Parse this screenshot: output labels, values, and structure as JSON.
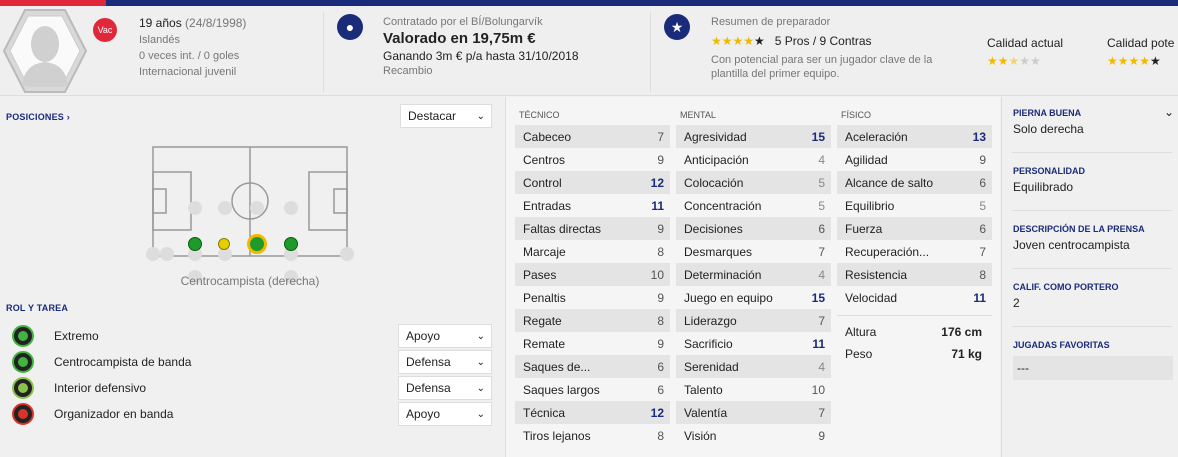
{
  "header": {
    "badge": "Vac",
    "age": "19 años",
    "dob": "(24/8/1998)",
    "nationality": "Islandés",
    "caps": "0 veces int. / 0 goles",
    "youth": "Internacional juvenil",
    "contract_label": "Contratado por el BÍ/Bolungarvík",
    "value": "Valorado en 19,75m €",
    "wage": "Ganando 3m € p/a hasta 31/10/2018",
    "status": "Recambio",
    "coach_title": "Resumen de preparador",
    "pros_cons": "5 Pros / 9 Contras",
    "coach_note_1": "Con potencial para ser un jugador clave de la",
    "coach_note_2": "plantilla del primer equipo.",
    "current_ability_label": "Calidad actual",
    "potential_ability_label": "Calidad pote",
    "coach_stars": 4,
    "current_stars": 2.5,
    "potential_stars": 4
  },
  "positions": {
    "title": "POSICIONES",
    "highlight": "Destacar",
    "position_label": "Centrocampista (derecha)"
  },
  "roles": {
    "title": "ROL Y TAREA",
    "items": [
      {
        "name": "Extremo",
        "duty": "Apoyo",
        "color": "#3fb53f"
      },
      {
        "name": "Centrocampista de banda",
        "duty": "Defensa",
        "color": "#3fb53f"
      },
      {
        "name": "Interior defensivo",
        "duty": "Defensa",
        "color": "#8bc34a"
      },
      {
        "name": "Organizador en banda",
        "duty": "Apoyo",
        "color": "#d9342b"
      }
    ]
  },
  "attributes": {
    "technical_title": "TÉCNICO",
    "mental_title": "MENTAL",
    "physical_title": "FÍSICO",
    "technical": [
      {
        "name": "Cabeceo",
        "value": "7"
      },
      {
        "name": "Centros",
        "value": "9"
      },
      {
        "name": "Control",
        "value": "12"
      },
      {
        "name": "Entradas",
        "value": "11"
      },
      {
        "name": "Faltas directas",
        "value": "9"
      },
      {
        "name": "Marcaje",
        "value": "8"
      },
      {
        "name": "Pases",
        "value": "10"
      },
      {
        "name": "Penaltis",
        "value": "9"
      },
      {
        "name": "Regate",
        "value": "8"
      },
      {
        "name": "Remate",
        "value": "9"
      },
      {
        "name": "Saques de...",
        "value": "6"
      },
      {
        "name": "Saques largos",
        "value": "6"
      },
      {
        "name": "Técnica",
        "value": "12"
      },
      {
        "name": "Tiros lejanos",
        "value": "8"
      }
    ],
    "mental": [
      {
        "name": "Agresividad",
        "value": "15"
      },
      {
        "name": "Anticipación",
        "value": "4"
      },
      {
        "name": "Colocación",
        "value": "5"
      },
      {
        "name": "Concentración",
        "value": "5"
      },
      {
        "name": "Decisiones",
        "value": "6"
      },
      {
        "name": "Desmarques",
        "value": "7"
      },
      {
        "name": "Determinación",
        "value": "4"
      },
      {
        "name": "Juego en equipo",
        "value": "15"
      },
      {
        "name": "Liderazgo",
        "value": "7"
      },
      {
        "name": "Sacrificio",
        "value": "11"
      },
      {
        "name": "Serenidad",
        "value": "4"
      },
      {
        "name": "Talento",
        "value": "10"
      },
      {
        "name": "Valentía",
        "value": "7"
      },
      {
        "name": "Visión",
        "value": "9"
      }
    ],
    "physical": [
      {
        "name": "Aceleración",
        "value": "13"
      },
      {
        "name": "Agilidad",
        "value": "9"
      },
      {
        "name": "Alcance de salto",
        "value": "6"
      },
      {
        "name": "Equilibrio",
        "value": "5"
      },
      {
        "name": "Fuerza",
        "value": "6"
      },
      {
        "name": "Recuperación...",
        "value": "7"
      },
      {
        "name": "Resistencia",
        "value": "8"
      },
      {
        "name": "Velocidad",
        "value": "11"
      }
    ],
    "height_label": "Altura",
    "height": "176 cm",
    "weight_label": "Peso",
    "weight": "71 kg"
  },
  "profile": {
    "foot_label": "PIERNA BUENA",
    "foot": "Solo derecha",
    "personality_label": "PERSONALIDAD",
    "personality": "Equilibrado",
    "press_label": "DESCRIPCIÓN DE LA PRENSA",
    "press": "Joven centrocampista",
    "gk_label": "CALIF. COMO PORTERO",
    "gk": "2",
    "moves_label": "JUGADAS FAVORITAS",
    "moves": "---"
  },
  "colors": {
    "accent": "#1a2b7a",
    "brand_red": "#e0283a",
    "star": "#f2b800"
  }
}
